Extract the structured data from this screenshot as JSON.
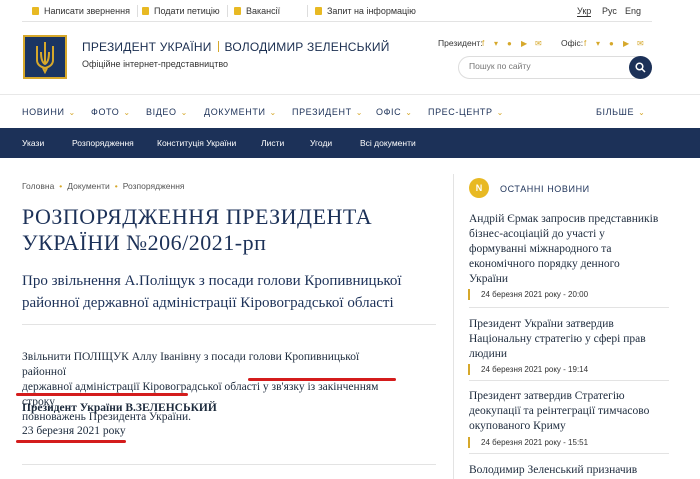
{
  "topbar": {
    "links": [
      "Написати звернення",
      "Подати петицію",
      "Вакансії",
      "Запит на інформацію"
    ],
    "languages": [
      "Укр",
      "Рус",
      "Eng"
    ]
  },
  "header": {
    "title_left": "ПРЕЗИДЕНТ УКРАЇНИ",
    "title_right": "ВОЛОДИМИР ЗЕЛЕНСЬКИЙ",
    "subtitle": "Офіційне інтернет-представництво",
    "president_label": "Президент:",
    "office_label": "Офіс:",
    "search_placeholder": "Пошук по сайту",
    "social_icons": [
      "facebook-icon",
      "twitter-icon",
      "telegram-icon",
      "youtube-icon",
      "email-icon"
    ]
  },
  "main_nav": [
    "НОВИНИ",
    "ФОТО",
    "ВІДЕО",
    "ДОКУМЕНТИ",
    "ПРЕЗИДЕНТ",
    "ОФІС",
    "ПРЕС-ЦЕНТР",
    "БІЛЬШЕ"
  ],
  "sub_nav": [
    "Укази",
    "Розпорядження",
    "Конституція України",
    "Листи",
    "Угоди",
    "Всі документи"
  ],
  "breadcrumb": [
    "Головна",
    "Документи",
    "Розпорядження"
  ],
  "document": {
    "title_line1": "РОЗПОРЯДЖЕННЯ ПРЕЗИДЕНТА",
    "title_line2": "УКРАЇНИ №206/2021-рп",
    "subject_line1": "Про звільнення А.Поліщук з посади голови Кропивницької",
    "subject_line2": "районної державної адміністрації Кіровоградської області",
    "body_line1": "Звільнити ПОЛІЩУК Аллу Іванівну з посади голови Кропивницької районної",
    "body_line2": "державної адміністрації Кіровоградської області у зв'язку із закінченням строку",
    "body_line3": "повноважень Президента України.",
    "signer": "Президент України В.ЗЕЛЕНСЬКИЙ",
    "date": "23 березня 2021 року"
  },
  "sidebar": {
    "badge": "N",
    "heading": "ОСТАННІ НОВИНИ",
    "news": [
      {
        "lines": [
          "Андрій Єрмак запросив представників",
          "бізнес-асоціацій до участі у",
          "формуванні міжнародного та",
          "економічного порядку денного",
          "України"
        ],
        "date": "24 березня 2021 року - 20:00"
      },
      {
        "lines": [
          "Президент України затвердив",
          "Національну стратегію у сфері прав",
          "людини"
        ],
        "date": "24 березня 2021 року - 19:14"
      },
      {
        "lines": [
          "Президент затвердив Стратегію",
          "деокупації та реінтеграції тимчасово",
          "окупованого Криму"
        ],
        "date": "24 березня 2021 року - 15:51"
      },
      {
        "lines": [
          "Володимир Зеленський призначив"
        ],
        "date": ""
      }
    ]
  },
  "colors": {
    "navy": "#1c3158",
    "gold": "#d6a82b",
    "annotation_red": "#d41c1c"
  }
}
